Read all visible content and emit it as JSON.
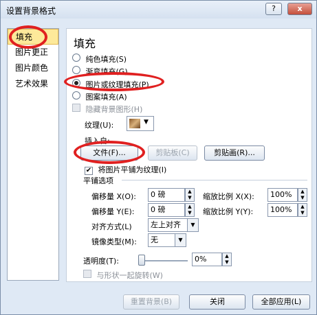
{
  "window": {
    "title": "设置背景格式",
    "help_label": "?",
    "close_label": "x"
  },
  "sidebar": {
    "items": [
      {
        "label": "填充"
      },
      {
        "label": "图片更正"
      },
      {
        "label": "图片颜色"
      },
      {
        "label": "艺术效果"
      }
    ]
  },
  "fill": {
    "heading": "填充",
    "options": [
      {
        "label": "纯色填充(S)"
      },
      {
        "label": "渐变填充(G)"
      },
      {
        "label": "图片或纹理填充(P)"
      },
      {
        "label": "图案填充(A)"
      }
    ],
    "hide_bg_label": "隐藏背景图形(H)",
    "texture_label": "纹理(U):",
    "insert_from_label": "插入自:",
    "file_button": "文件(F)...",
    "clipboard_button": "剪贴板(C)",
    "clipart_button": "剪贴画(R)...",
    "tile_label": "将图片平铺为纹理(I)",
    "tile_options_heading": "平铺选项",
    "offset_x_label": "偏移量 X(O):",
    "offset_x_value": "0 磅",
    "scale_x_label": "缩放比例 X(X):",
    "scale_x_value": "100%",
    "offset_y_label": "偏移量 Y(E):",
    "offset_y_value": "0 磅",
    "scale_y_label": "缩放比例 Y(Y):",
    "scale_y_value": "100%",
    "align_label": "对齐方式(L)",
    "align_value": "左上对齐",
    "mirror_label": "镜像类型(M):",
    "mirror_value": "无",
    "transparency_label": "透明度(T):",
    "transparency_value": "0%",
    "transparency_level": 0,
    "rotate_label": "与形状一起旋转(W)"
  },
  "footer": {
    "reset_button": "重置背景(B)",
    "close_button": "关闭",
    "apply_all_button": "全部应用(L)"
  },
  "colors": {
    "annotation": "#e02020",
    "selected_tab": "#fde99a"
  }
}
